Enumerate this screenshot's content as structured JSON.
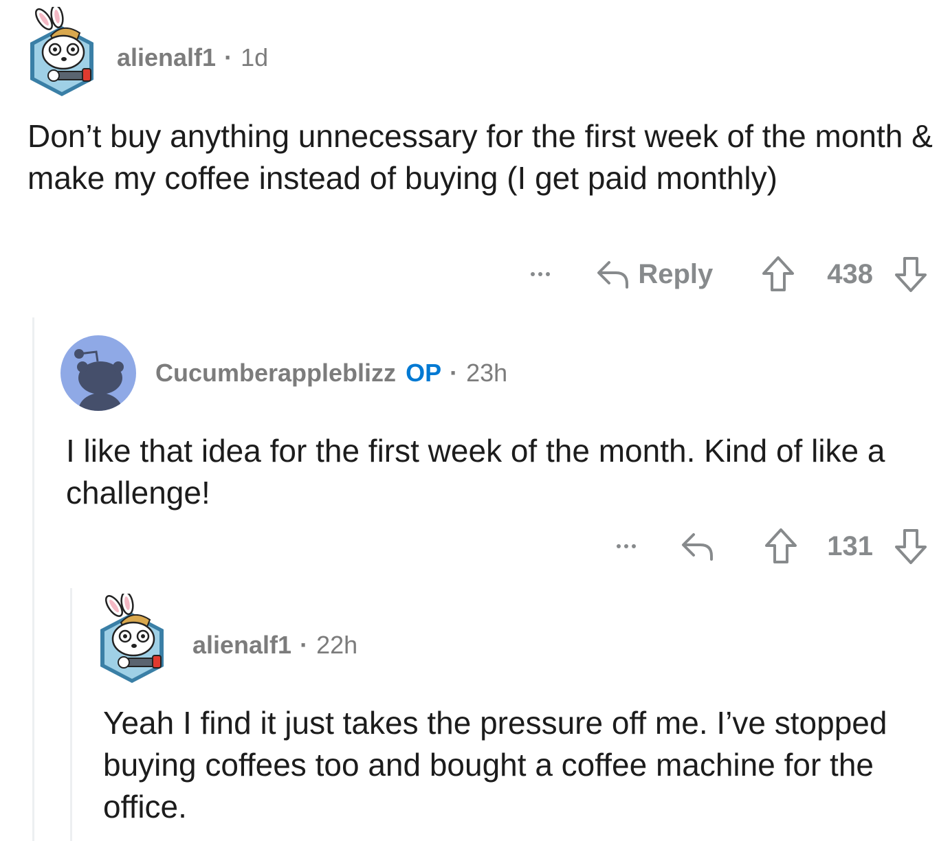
{
  "comments": [
    {
      "username": "alienalf1",
      "is_op": false,
      "op_label": "",
      "separator": "·",
      "time": "1d",
      "avatar": "snoo-bunny-avatar-icon",
      "body": "Don’t buy anything unnecessary for the first week of the month & make my coffee instead of buying (I get paid monthly)",
      "more_label": "…",
      "reply_label": "Reply",
      "score": "438"
    },
    {
      "username": "Cucumberappleblizz",
      "is_op": true,
      "op_label": "OP",
      "separator": "·",
      "time": "23h",
      "avatar": "default-snoo-avatar-icon",
      "body": "I like that idea for the first week of the month. Kind of like a challenge!",
      "more_label": "…",
      "reply_label": "",
      "score": "131"
    },
    {
      "username": "alienalf1",
      "is_op": false,
      "op_label": "",
      "separator": "·",
      "time": "22h",
      "avatar": "snoo-bunny-avatar-icon",
      "body": "Yeah I find it just takes the pressure off me. I’ve stopped buying coffees too and bought a coffee machine for the office."
    }
  ],
  "colors": {
    "meta_gray": "#7c7c7c",
    "action_gray": "#878a8c",
    "op_blue": "#0079d3",
    "thread_line": "#edeff1",
    "default_avatar_bg": "#8fa9e6"
  }
}
